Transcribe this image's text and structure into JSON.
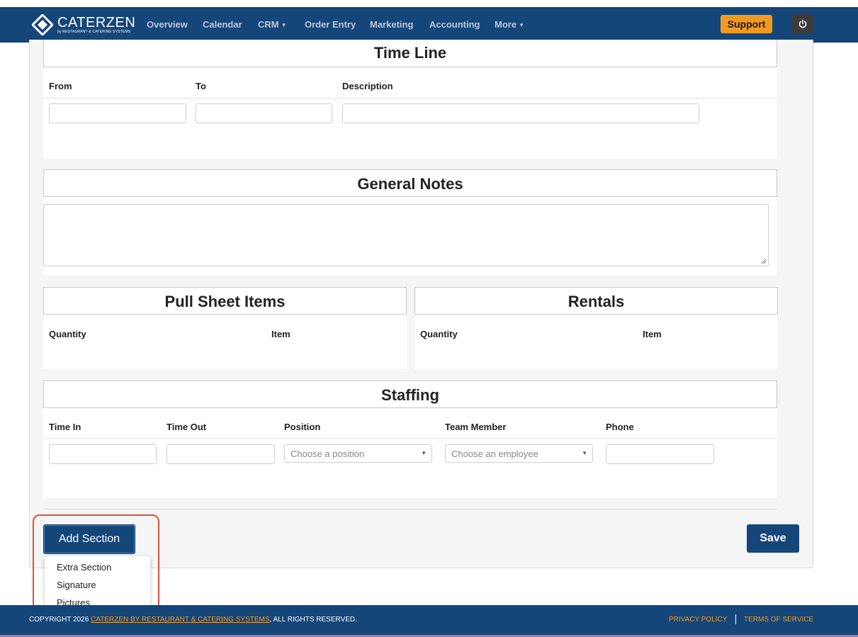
{
  "nav": {
    "logo_text": "CATERZEN",
    "logo_sub": "by RESTAURANT & CATERING SYSTEMS",
    "items": [
      "Overview",
      "Calendar",
      "CRM",
      "Order Entry",
      "Marketing",
      "Accounting",
      "More"
    ],
    "support_label": "Support"
  },
  "timeline": {
    "title": "Time Line",
    "columns": [
      "From",
      "To",
      "Description"
    ]
  },
  "general_notes": {
    "title": "General Notes"
  },
  "pull_sheet": {
    "title": "Pull Sheet Items",
    "columns": [
      "Quantity",
      "Item"
    ]
  },
  "rentals": {
    "title": "Rentals",
    "columns": [
      "Quantity",
      "Item"
    ]
  },
  "staffing": {
    "title": "Staffing",
    "columns": [
      "Time In",
      "Time Out",
      "Position",
      "Team Member",
      "Phone"
    ],
    "position_placeholder": "Choose a position",
    "employee_placeholder": "Choose an employee"
  },
  "actions": {
    "add_section_label": "Add Section",
    "save_label": "Save",
    "menu": [
      "Extra Section",
      "Signature",
      "Pictures"
    ]
  },
  "footer": {
    "copyright_prefix": "COPYRIGHT 2026 ",
    "copyright_link": "CATERZEN BY RESTAURANT & CATERING SYSTEMS",
    "copyright_suffix": ", ALL RIGHTS RESERVED.",
    "privacy": "PRIVACY POLICY",
    "terms": "TERMS OF SERVICE"
  },
  "colors": {
    "brand_blue": "#15467a",
    "accent_orange": "#f29a1f",
    "highlight_red": "#e0523a"
  }
}
